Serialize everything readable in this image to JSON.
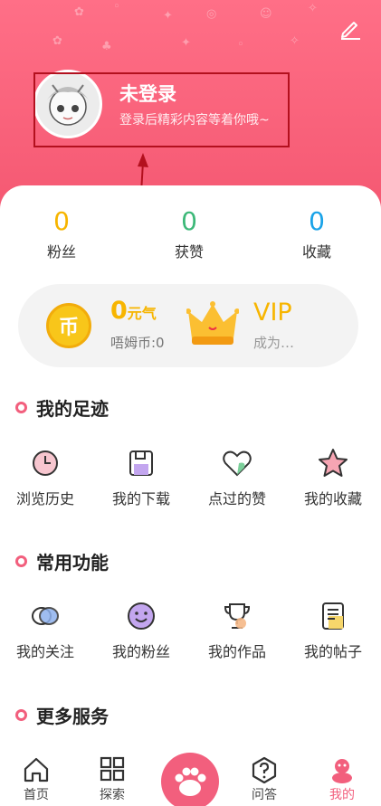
{
  "profile": {
    "name": "未登录",
    "subtitle": "登录后精彩内容等着你哦~"
  },
  "stats": [
    {
      "value": "0",
      "label": "粉丝",
      "color": "#f7b500"
    },
    {
      "value": "0",
      "label": "获赞",
      "color": "#3cb878"
    },
    {
      "value": "0",
      "label": "收藏",
      "color": "#1aa3e8"
    }
  ],
  "wallet": {
    "coin_symbol": "币",
    "energy_value": "0",
    "energy_unit": "元气",
    "coin_label": "唔姆币:0",
    "vip_title": "VIP",
    "vip_subtitle": "成为…"
  },
  "sections": {
    "footprint": {
      "title": "我的足迹",
      "items": [
        {
          "label": "浏览历史",
          "icon": "history-clock-icon"
        },
        {
          "label": "我的下载",
          "icon": "download-save-icon"
        },
        {
          "label": "点过的赞",
          "icon": "heart-icon"
        },
        {
          "label": "我的收藏",
          "icon": "star-icon"
        }
      ]
    },
    "common": {
      "title": "常用功能",
      "items": [
        {
          "label": "我的关注",
          "icon": "follow-eye-icon"
        },
        {
          "label": "我的粉丝",
          "icon": "fans-smile-icon"
        },
        {
          "label": "我的作品",
          "icon": "trophy-icon"
        },
        {
          "label": "我的帖子",
          "icon": "post-note-icon"
        }
      ]
    },
    "more": {
      "title": "更多服务"
    }
  },
  "tabbar": {
    "tabs": [
      {
        "label": "首页",
        "icon": "home-icon"
      },
      {
        "label": "探索",
        "icon": "grid-icon"
      },
      {
        "label": "问答",
        "icon": "question-icon"
      },
      {
        "label": "我的",
        "icon": "mascot-icon"
      }
    ],
    "active": "我的"
  },
  "colors": {
    "brand_pink": "#f25f7d",
    "gold": "#f7b500",
    "annotation_red": "#b3101e"
  }
}
